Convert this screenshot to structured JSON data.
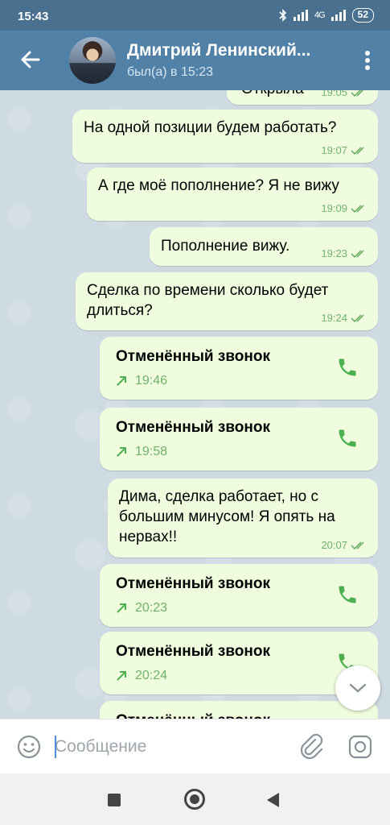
{
  "status_bar": {
    "time": "15:43",
    "icons": [
      "bluetooth-icon",
      "signal-icon",
      "signal-4g-icon"
    ],
    "network": "4G",
    "battery": "52"
  },
  "header": {
    "title": "Дмитрий Ленинский...",
    "subtitle": "был(а) в 15:23"
  },
  "messages": [
    {
      "type": "text",
      "text": "Открыла",
      "time": "19:05",
      "read": true
    },
    {
      "type": "text",
      "text": "На одной позиции будем работать?",
      "time": "19:07",
      "read": true
    },
    {
      "type": "text",
      "text": "А где моё пополнение? Я не вижу",
      "time": "19:09",
      "read": true
    },
    {
      "type": "text",
      "text": "Пополнение вижу.",
      "time": "19:23",
      "read": true
    },
    {
      "type": "text",
      "text": "Сделка по времени сколько будет длиться?",
      "time": "19:24",
      "read": true
    },
    {
      "type": "call",
      "title": "Отменённый звонок",
      "time": "19:46"
    },
    {
      "type": "call",
      "title": "Отменённый звонок",
      "time": "19:58"
    },
    {
      "type": "text",
      "text": "Дима, сделка работает, но с большим минусом! Я опять на нервах!!",
      "time": "20:07",
      "read": true
    },
    {
      "type": "call",
      "title": "Отменённый звонок",
      "time": "20:23"
    },
    {
      "type": "call",
      "title": "Отменённый звонок",
      "time": "20:24"
    },
    {
      "type": "call",
      "title": "Отменённый звонок",
      "time": ""
    }
  ],
  "input": {
    "placeholder": "Сообщение"
  },
  "colors": {
    "header": "#5281a8",
    "statusbar": "#4a708f",
    "bubble": "#effdde",
    "accent_green": "#6fb169",
    "phone_green": "#4caf50"
  }
}
